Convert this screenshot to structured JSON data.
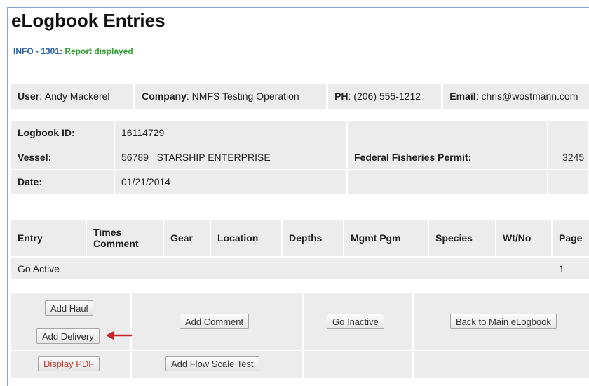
{
  "page": {
    "title": "eLogbook Entries",
    "info_code": "INFO - 1301:",
    "info_message": "Report displayed"
  },
  "user_bar": {
    "user_label": "User",
    "user_value": "Andy Mackerel",
    "company_label": "Company",
    "company_value": "NMFS Testing Operation",
    "phone_label": "PH",
    "phone_value": "(206) 555-1212",
    "email_label": "Email",
    "email_value": "chris@wostmann.com"
  },
  "logbook": {
    "id_label": "Logbook ID:",
    "id_value": "16114729",
    "vessel_label": "Vessel:",
    "vessel_number": "56789",
    "vessel_name": "STARSHIP ENTERPRISE",
    "permit_label": "Federal Fisheries Permit:",
    "permit_value": "3245",
    "date_label": "Date:",
    "date_value": "01/21/2014"
  },
  "entries_table": {
    "headers": [
      "Entry",
      "Times Comment",
      "Gear",
      "Location",
      "Depths",
      "Mgmt Pgm",
      "Species",
      "Wt/No",
      "Page"
    ],
    "times_line1": "Times",
    "times_line2": "Comment",
    "rows": [
      {
        "entry": "Go Active",
        "page": "1"
      }
    ]
  },
  "actions": {
    "add_haul": "Add Haul",
    "add_delivery": "Add Delivery",
    "display_pdf": "Display PDF",
    "add_comment": "Add Comment",
    "add_flow_scale_test": "Add Flow Scale Test",
    "go_inactive": "Go Inactive",
    "back_to_main": "Back to Main eLogbook"
  },
  "colors": {
    "info_code": "#2c5ea8",
    "info_message": "#2e9b2e",
    "arrow": "#c0282a",
    "pdf_text": "#c0392b",
    "frame": "#7fa6d6"
  }
}
